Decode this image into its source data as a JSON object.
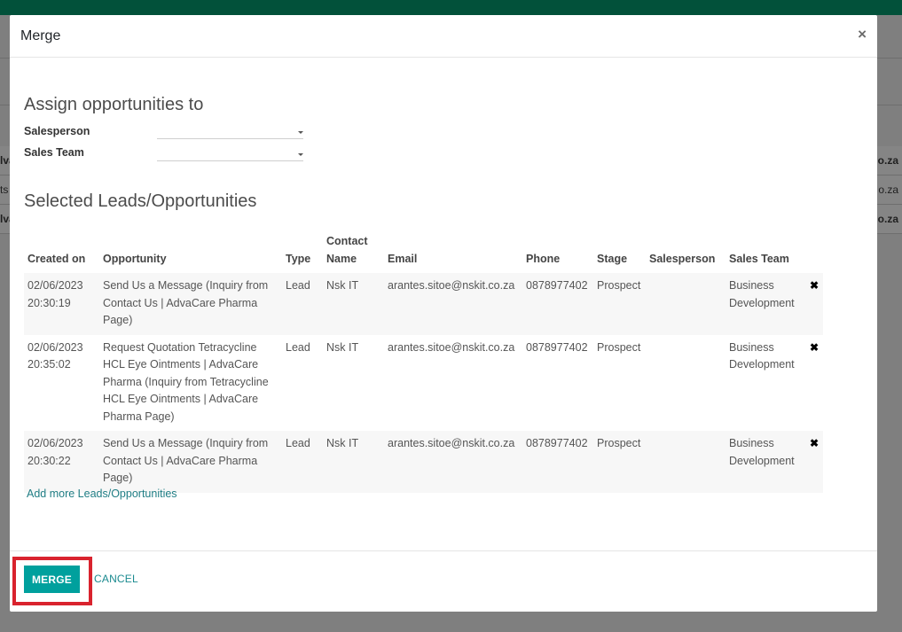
{
  "background": {
    "row_fragments": [
      {
        "left": "lva",
        "right": "o.za"
      },
      {
        "left": "ts",
        "right": "o.za"
      },
      {
        "left": "lva",
        "right": "o.za"
      }
    ]
  },
  "modal": {
    "title": "Merge",
    "close_glyph": "×",
    "assign": {
      "title": "Assign opportunities to",
      "salesperson_label": "Salesperson",
      "salesperson_value": "",
      "sales_team_label": "Sales Team",
      "sales_team_value": ""
    },
    "selected": {
      "title": "Selected Leads/Opportunities",
      "columns": [
        "Created on",
        "Opportunity",
        "Type",
        "Contact Name",
        "Email",
        "Phone",
        "Stage",
        "Salesperson",
        "Sales Team"
      ],
      "rows": [
        {
          "created_on": "02/06/2023 20:30:19",
          "opportunity": "Send Us a Message (Inquiry from Contact Us | AdvaCare Pharma Page)",
          "type": "Lead",
          "contact_name": "Nsk IT",
          "email": "arantes.sitoe@nskit.co.za",
          "phone": "0878977402",
          "stage": "Prospect",
          "salesperson": "",
          "sales_team": "Business Development"
        },
        {
          "created_on": "02/06/2023 20:35:02",
          "opportunity": "Request Quotation Tetracycline HCL Eye Ointments | AdvaCare Pharma (Inquiry from Tetracycline HCL Eye Ointments | AdvaCare Pharma Page)",
          "type": "Lead",
          "contact_name": "Nsk IT",
          "email": "arantes.sitoe@nskit.co.za",
          "phone": "0878977402",
          "stage": "Prospect",
          "salesperson": "",
          "sales_team": "Business Development"
        },
        {
          "created_on": "02/06/2023 20:30:22",
          "opportunity": "Send Us a Message (Inquiry from Contact Us | AdvaCare Pharma Page)",
          "type": "Lead",
          "contact_name": "Nsk IT",
          "email": "arantes.sitoe@nskit.co.za",
          "phone": "0878977402",
          "stage": "Prospect",
          "salesperson": "",
          "sales_team": "Business Development"
        }
      ],
      "remove_glyph": "✖",
      "add_more": "Add more Leads/Opportunities"
    },
    "footer": {
      "merge_label": "MERGE",
      "cancel_label": "CANCEL"
    }
  },
  "colors": {
    "topbar": "#02513a",
    "primary": "#00a09d",
    "link": "#1f7d84",
    "highlight": "#d9232e"
  }
}
